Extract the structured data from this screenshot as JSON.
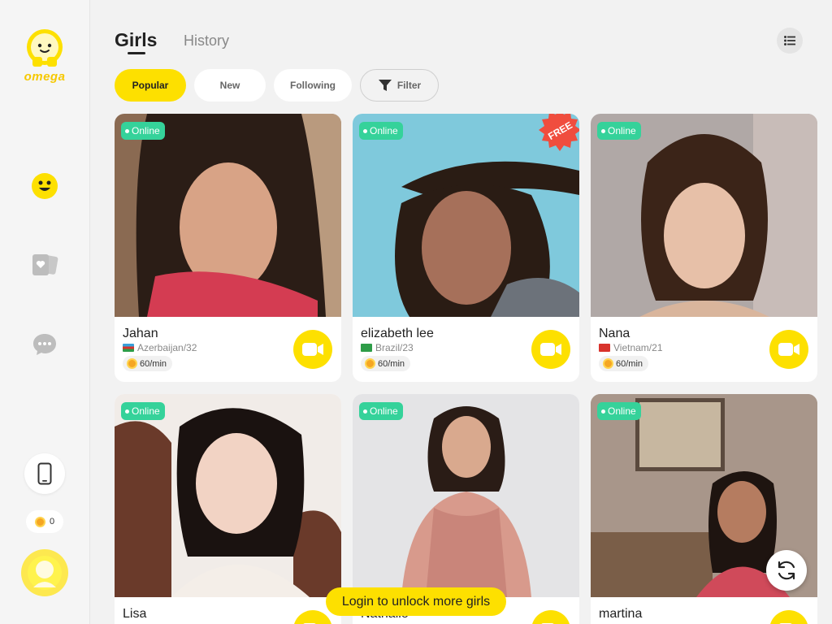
{
  "brand": {
    "logo_text": "omega"
  },
  "colors": {
    "accent": "#fde000",
    "online": "#35d29a",
    "free_badge": "#f04d3e"
  },
  "header": {
    "tabs": [
      {
        "label": "Girls",
        "active": true
      },
      {
        "label": "History",
        "active": false
      }
    ],
    "menu_icon": "list-icon"
  },
  "filters": {
    "pills": [
      {
        "label": "Popular",
        "active": true
      },
      {
        "label": "New",
        "active": false
      },
      {
        "label": "Following",
        "active": false
      },
      {
        "label": "Filter",
        "icon": "filter-icon"
      }
    ]
  },
  "sidebar": {
    "icons": [
      "smiley-icon",
      "cards-icon",
      "chat-icon",
      "phone-icon"
    ],
    "coins": "0"
  },
  "cards": [
    {
      "name": "Jahan",
      "country": "Azerbaijan/32",
      "price": "60/min",
      "status": "Online",
      "free": false
    },
    {
      "name": "elizabeth lee",
      "country": "Brazil/23",
      "price": "60/min",
      "status": "Online",
      "free": true,
      "badge": "FREE"
    },
    {
      "name": "Nana",
      "country": "Vietnam/21",
      "price": "60/min",
      "status": "Online",
      "free": false
    },
    {
      "name": "Lisa",
      "status": "Online"
    },
    {
      "name": "Nathalie",
      "status": "Online"
    },
    {
      "name": "martina",
      "status": "Online"
    }
  ],
  "login_banner": "Login to unlock more girls"
}
